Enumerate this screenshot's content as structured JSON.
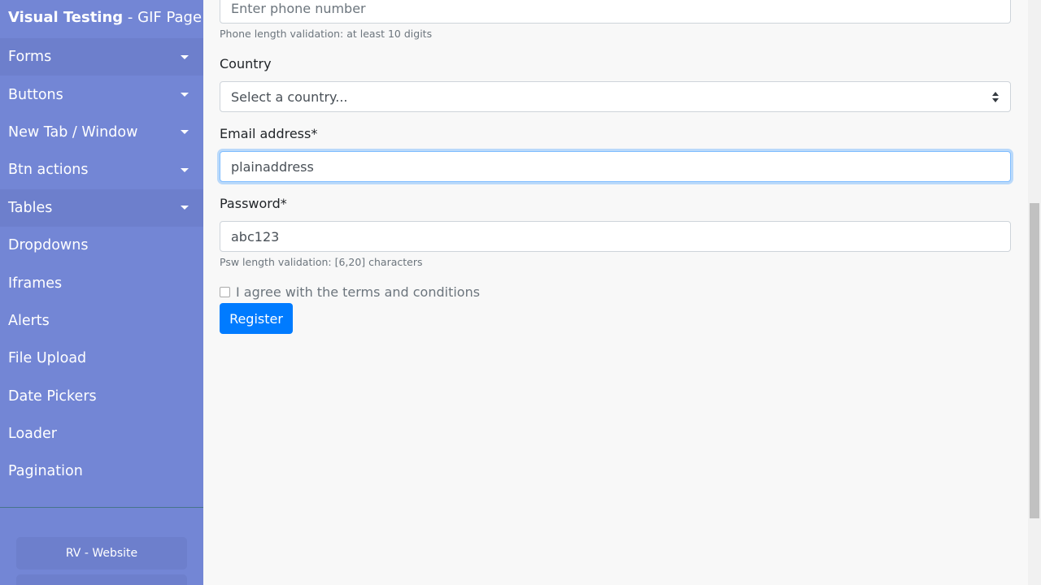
{
  "sidebar": {
    "brand_strong": "Visual Testing",
    "brand_light": " - GIF Page",
    "items": [
      {
        "label": "Forms",
        "has_caret": true
      },
      {
        "label": "Buttons",
        "has_caret": true
      },
      {
        "label": "New Tab / Window",
        "has_caret": true
      },
      {
        "label": "Btn actions",
        "has_caret": true
      },
      {
        "label": "Tables",
        "has_caret": true
      },
      {
        "label": "Dropdowns",
        "has_caret": false
      },
      {
        "label": "Iframes",
        "has_caret": false
      },
      {
        "label": "Alerts",
        "has_caret": false
      },
      {
        "label": "File Upload",
        "has_caret": false
      },
      {
        "label": "Date Pickers",
        "has_caret": false
      },
      {
        "label": "Loader",
        "has_caret": false
      },
      {
        "label": "Pagination",
        "has_caret": false
      }
    ],
    "buttons": [
      "RV - Website",
      ""
    ]
  },
  "form": {
    "phone": {
      "placeholder": "Enter phone number",
      "help": "Phone length validation: at least 10 digits"
    },
    "country": {
      "label": "Country",
      "selected": "Select a country..."
    },
    "email": {
      "label": "Email address*",
      "value": "plainaddress"
    },
    "password": {
      "label": "Password*",
      "value": "abc123",
      "help": "Psw length validation: [6,20] characters"
    },
    "terms_label": "I agree with the terms and conditions",
    "register_label": "Register"
  },
  "colors": {
    "sidebar_bg": "#7386d5",
    "sidebar_active_bg": "#6d7fcc",
    "primary": "#007bff"
  }
}
